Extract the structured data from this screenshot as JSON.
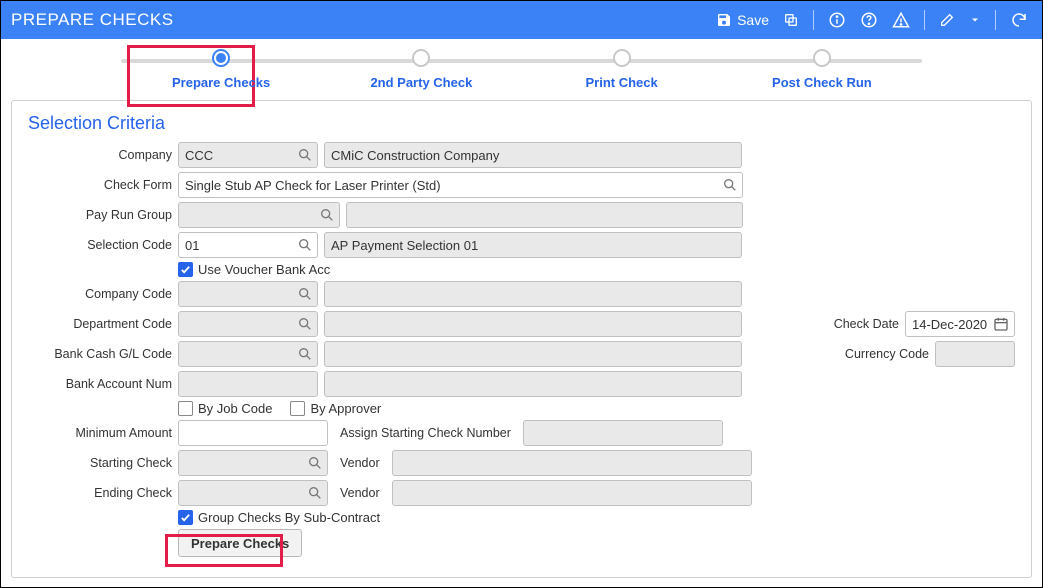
{
  "header": {
    "title": "PREPARE CHECKS",
    "save_label": "Save"
  },
  "stepper": {
    "steps": [
      {
        "label": "Prepare Checks",
        "active": true
      },
      {
        "label": "2nd Party Check",
        "active": false
      },
      {
        "label": "Print Check",
        "active": false
      },
      {
        "label": "Post Check Run",
        "active": false
      }
    ]
  },
  "panel": {
    "title": "Selection Criteria",
    "labels": {
      "company": "Company",
      "check_form": "Check Form",
      "pay_run_group": "Pay Run Group",
      "selection_code": "Selection Code",
      "use_voucher_bank": "Use Voucher Bank Acc",
      "company_code": "Company Code",
      "department_code": "Department Code",
      "bank_cash_gl": "Bank Cash G/L Code",
      "bank_account_num": "Bank Account Num",
      "by_job_code": "By Job Code",
      "by_approver": "By Approver",
      "minimum_amount": "Minimum Amount",
      "assign_starting_check_num": "Assign Starting Check Number",
      "starting_check": "Starting Check",
      "ending_check": "Ending Check",
      "vendor": "Vendor",
      "group_by_subcontract": "Group Checks By Sub-Contract",
      "check_date": "Check Date",
      "currency_code": "Currency Code",
      "prepare_checks_btn": "Prepare Checks"
    },
    "values": {
      "company_code": "CCC",
      "company_name": "CMiC Construction Company",
      "check_form": "Single Stub AP Check for Laser Printer (Std)",
      "pay_run_group_code": "",
      "pay_run_group_desc": "",
      "selection_code": "01",
      "selection_desc": "AP Payment Selection 01",
      "use_voucher_bank": true,
      "company_code2": "",
      "company_code2_desc": "",
      "department_code": "",
      "department_desc": "",
      "bank_cash_gl": "",
      "bank_cash_gl_desc": "",
      "bank_account_num": "",
      "bank_account_desc": "",
      "by_job_code": false,
      "by_approver": false,
      "minimum_amount": "",
      "assign_starting_check_num": "",
      "starting_check": "",
      "starting_vendor": "",
      "ending_check": "",
      "ending_vendor": "",
      "group_by_subcontract": true,
      "check_date": "14-Dec-2020",
      "currency_code": ""
    }
  }
}
